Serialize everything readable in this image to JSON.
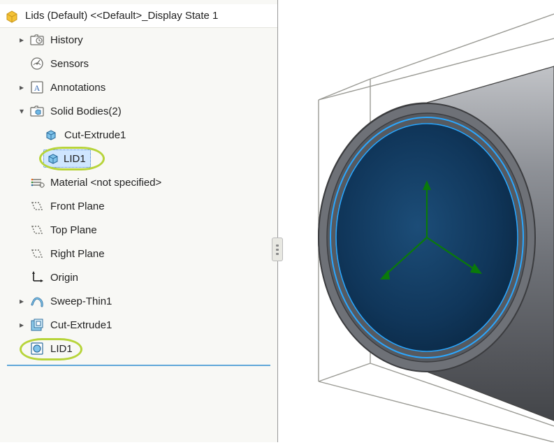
{
  "tree": {
    "root": "Lids (Default) <<Default>_Display State 1",
    "history": "History",
    "sensors": "Sensors",
    "annotations": "Annotations",
    "solid_bodies": "Solid Bodies(2)",
    "cut_extrude_body": "Cut-Extrude1",
    "lid1_body": "LID1",
    "material": "Material <not specified>",
    "front_plane": "Front Plane",
    "top_plane": "Top Plane",
    "right_plane": "Right Plane",
    "origin": "Origin",
    "sweep_thin": "Sweep-Thin1",
    "cut_extrude_feat": "Cut-Extrude1",
    "lid1_feat": "LID1"
  }
}
